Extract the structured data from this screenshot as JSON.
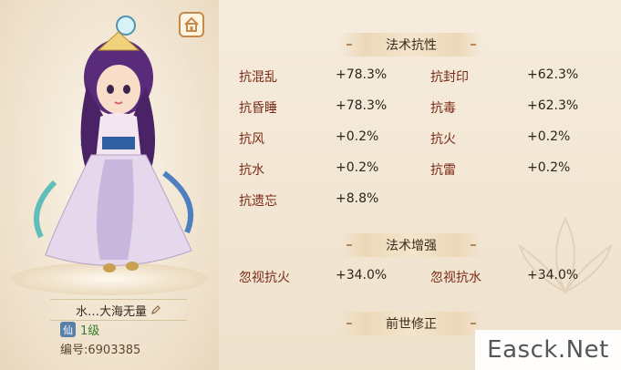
{
  "character": {
    "name": "水…大海无量",
    "badge": "仙",
    "level": "1级",
    "id_label": "编号:6903385"
  },
  "sections": {
    "resist_title": "法术抗性",
    "enhance_title": "法术增强",
    "past_life_title": "前世修正"
  },
  "resist": [
    {
      "name": "抗混乱",
      "value": "+78.3%"
    },
    {
      "name": "抗封印",
      "value": "+62.3%"
    },
    {
      "name": "抗昏睡",
      "value": "+78.3%"
    },
    {
      "name": "抗毒",
      "value": "+62.3%"
    },
    {
      "name": "抗风",
      "value": "+0.2%"
    },
    {
      "name": "抗火",
      "value": "+0.2%"
    },
    {
      "name": "抗水",
      "value": "+0.2%"
    },
    {
      "name": "抗雷",
      "value": "+0.2%"
    },
    {
      "name": "抗遗忘",
      "value": "+8.8%"
    }
  ],
  "enhance": [
    {
      "name": "忽视抗火",
      "value": "+34.0%"
    },
    {
      "name": "忽视抗水",
      "value": "+34.0%"
    }
  ],
  "watermark": "Easck.Net",
  "colors": {
    "stat_name": "#7a2a16",
    "accent": "#c48a4a"
  }
}
